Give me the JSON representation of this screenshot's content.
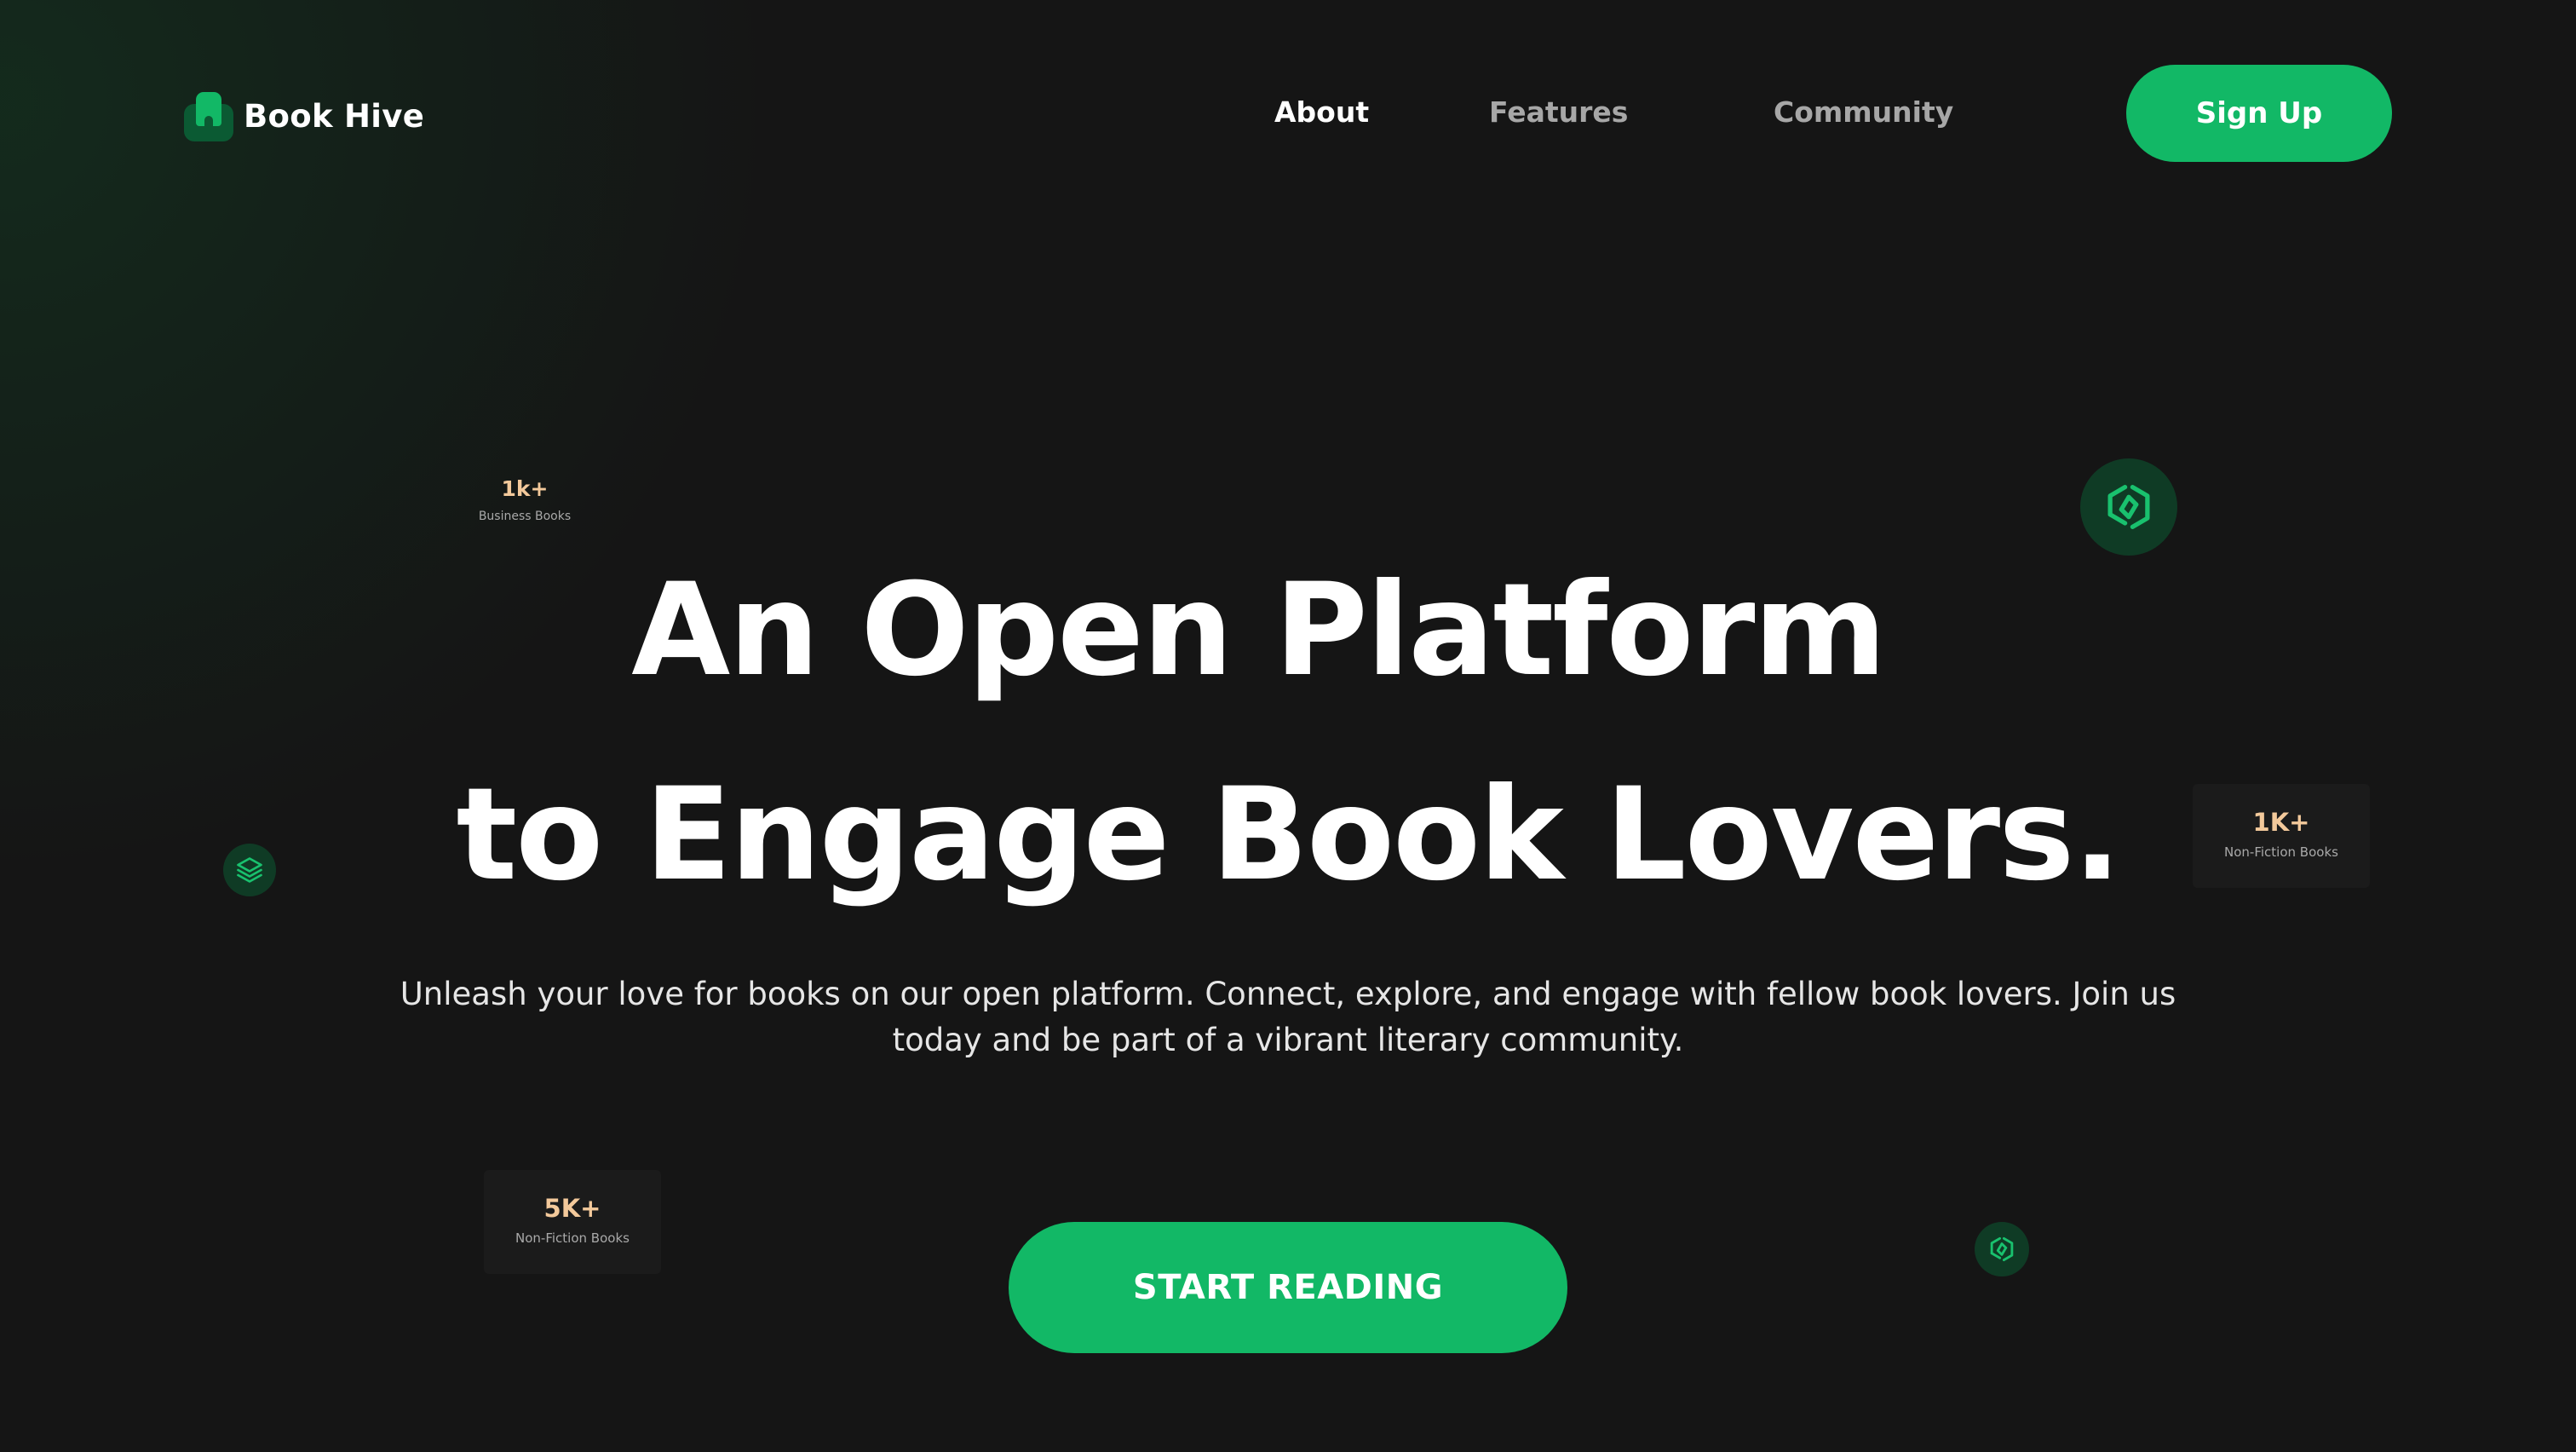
{
  "brand": {
    "name": "Book Hive",
    "accent_color": "#12b866",
    "background_color": "#151515",
    "stat_number_color": "#f3c99b"
  },
  "nav": {
    "items": [
      {
        "label": "About",
        "active": true
      },
      {
        "label": "Features",
        "active": false
      },
      {
        "label": "Community",
        "active": false
      }
    ],
    "signup_label": "Sign Up"
  },
  "hero": {
    "title_line1": "An Open Platform",
    "title_line2": "to Engage Book Lovers.",
    "description": "Unleash your love for books on our open platform. Connect, explore, and engage with fellow book lovers. Join us today and be part of a vibrant literary community.",
    "cta_label": "START READING"
  },
  "stats": [
    {
      "value": "1k+",
      "label": "Business Books"
    },
    {
      "value": "1K+",
      "label": "Non-Fiction Books"
    },
    {
      "value": "5K+",
      "label": "Non-Fiction Books"
    }
  ],
  "icons": {
    "logo": "book-bookmark-icon",
    "floating": [
      "hexagon-link-icon",
      "layers-icon",
      "hexagon-link-icon"
    ]
  }
}
